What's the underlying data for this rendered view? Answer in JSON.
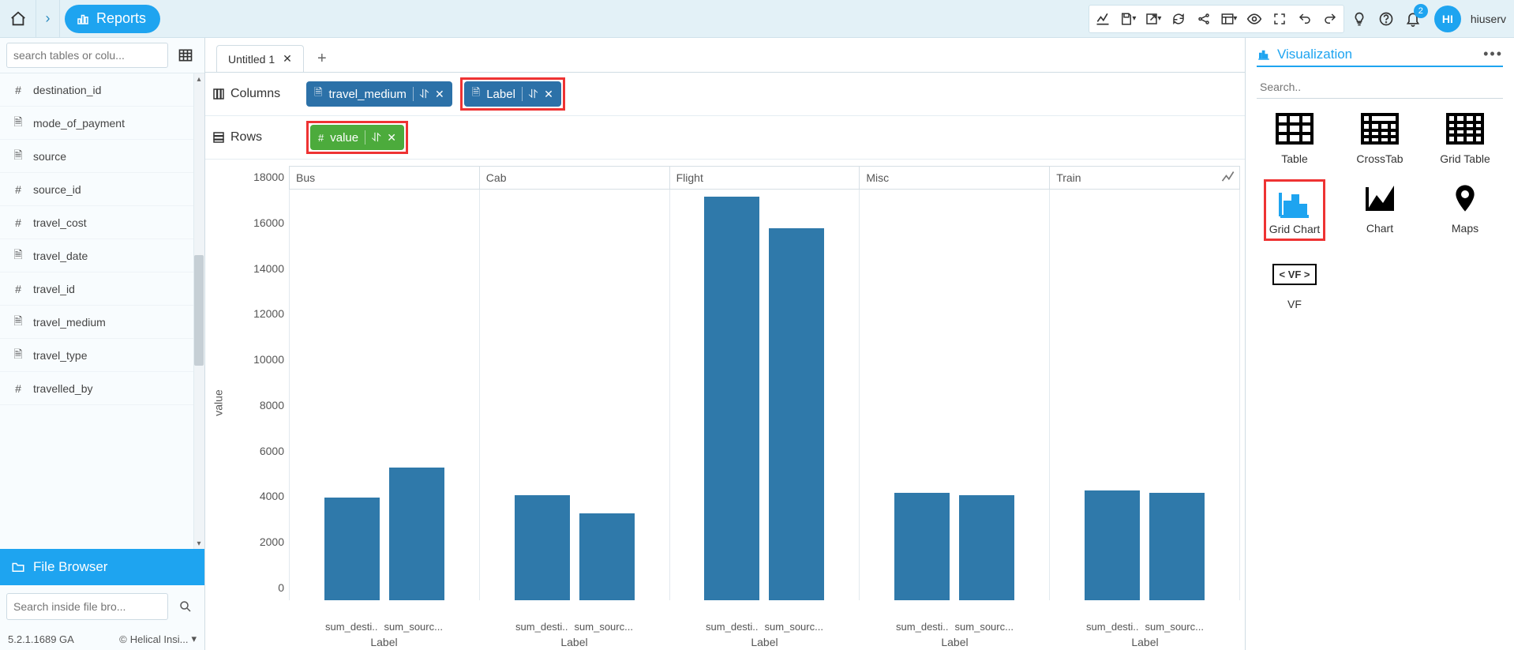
{
  "topbar": {
    "reports_label": "Reports",
    "username": "hiuserv",
    "avatar_initials": "HI",
    "notification_count": "2"
  },
  "sidebar": {
    "search_placeholder": "search tables or colu...",
    "fields": [
      {
        "icon": "#",
        "label": "destination_id"
      },
      {
        "icon": "doc",
        "label": "mode_of_payment"
      },
      {
        "icon": "doc",
        "label": "source"
      },
      {
        "icon": "#",
        "label": "source_id"
      },
      {
        "icon": "#",
        "label": "travel_cost"
      },
      {
        "icon": "doc",
        "label": "travel_date"
      },
      {
        "icon": "#",
        "label": "travel_id"
      },
      {
        "icon": "doc",
        "label": "travel_medium"
      },
      {
        "icon": "doc",
        "label": "travel_type"
      },
      {
        "icon": "#",
        "label": "travelled_by"
      }
    ],
    "file_browser_label": "File Browser",
    "file_browser_search_placeholder": "Search inside file bro...",
    "version": "5.2.1.1689 GA",
    "copyright": "Helical Insi..."
  },
  "tabs": {
    "tab1": "Untitled 1"
  },
  "shelves": {
    "columns_label": "Columns",
    "rows_label": "Rows",
    "col_pills": [
      {
        "icon": "doc",
        "label": "travel_medium"
      },
      {
        "icon": "doc",
        "label": "Label"
      }
    ],
    "row_pills": [
      {
        "icon": "#",
        "label": "value"
      }
    ]
  },
  "chart_data": {
    "type": "bar",
    "ylabel": "value",
    "xlabel_per_panel": "Label",
    "ylim": [
      0,
      18000
    ],
    "yticks": [
      0,
      2000,
      4000,
      6000,
      8000,
      10000,
      12000,
      14000,
      16000,
      18000
    ],
    "panels": [
      "Bus",
      "Cab",
      "Flight",
      "Misc",
      "Train"
    ],
    "x_categories": [
      "sum_desti..",
      "sum_sourc..."
    ],
    "series": [
      {
        "panel": "Bus",
        "values": [
          4500,
          5800
        ]
      },
      {
        "panel": "Cab",
        "values": [
          4600,
          3800
        ]
      },
      {
        "panel": "Flight",
        "values": [
          17700,
          16300
        ]
      },
      {
        "panel": "Misc",
        "values": [
          4700,
          4600
        ]
      },
      {
        "panel": "Train",
        "values": [
          4800,
          4700
        ]
      }
    ]
  },
  "vis_panel": {
    "title": "Visualization",
    "search_placeholder": "Search..",
    "items": [
      "Table",
      "CrossTab",
      "Grid Table",
      "Grid Chart",
      "Chart",
      "Maps",
      "VF"
    ]
  }
}
